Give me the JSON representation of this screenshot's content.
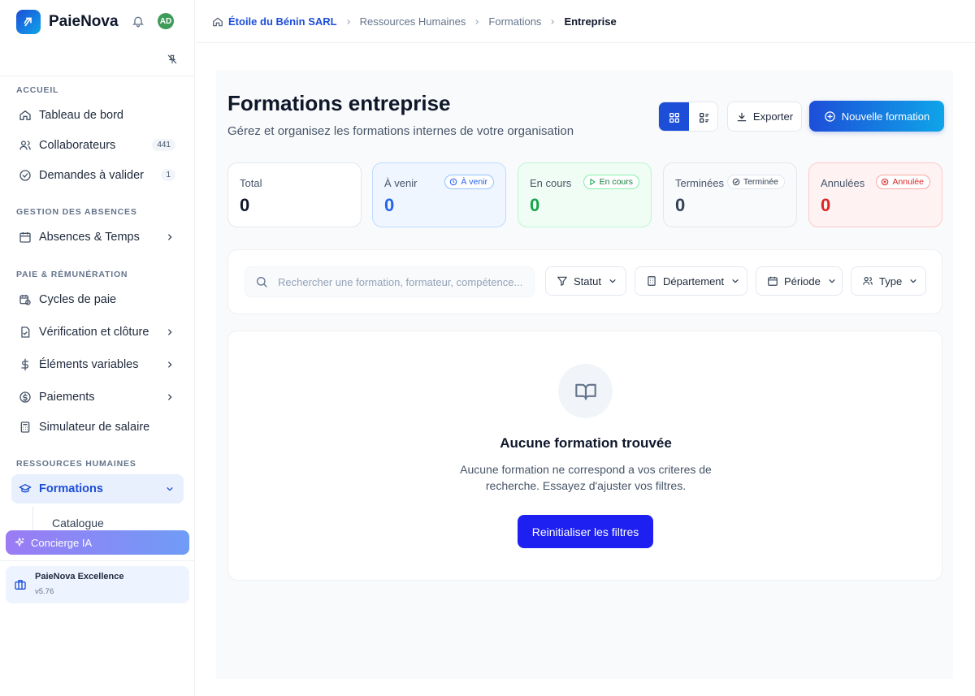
{
  "app": {
    "name": "PaieNova",
    "user_initials": "AD"
  },
  "sidebar": {
    "sections": {
      "accueil": "ACCUEIL",
      "absences": "GESTION DES ABSENCES",
      "paie": "PAIE & RÉMUNÉRATION",
      "rh": "RESSOURCES HUMAINES"
    },
    "items": {
      "dashboard": {
        "label": "Tableau de bord",
        "icon": "home-icon"
      },
      "collaborateurs": {
        "label": "Collaborateurs",
        "badge": "441",
        "icon": "users-icon"
      },
      "demandes": {
        "label": "Demandes à valider",
        "badge": "1",
        "icon": "check-circle-icon"
      },
      "absences": {
        "label": "Absences & Temps",
        "icon": "calendar-icon"
      },
      "cycles": {
        "label": "Cycles de paie",
        "icon": "calendar-clock-icon"
      },
      "verification": {
        "label": "Vérification et clôture",
        "icon": "file-check-icon"
      },
      "elements": {
        "label": "Éléments variables",
        "icon": "dollar-icon"
      },
      "paiements": {
        "label": "Paiements",
        "icon": "coin-icon"
      },
      "simulateur": {
        "label": "Simulateur de salaire",
        "icon": "calculator-icon"
      },
      "formations": {
        "label": "Formations",
        "icon": "graduation-cap-icon"
      }
    },
    "sub_items": {
      "catalogue": "Catalogue"
    },
    "concierge": "Concierge IA",
    "version": {
      "name": "PaieNova Excellence",
      "number": "v5.76"
    }
  },
  "breadcrumb": {
    "company": "Étoile du Bénin SARL",
    "rh": "Ressources Humaines",
    "formations": "Formations",
    "current": "Entreprise"
  },
  "header": {
    "title": "Formations entreprise",
    "subtitle": "Gérez et organisez les formations internes de votre organisation",
    "export_label": "Exporter",
    "new_label": "Nouvelle formation"
  },
  "stats": {
    "total": {
      "label": "Total",
      "value": "0"
    },
    "a_venir": {
      "label": "À venir",
      "value": "0",
      "pill": "À venir",
      "color": "#2563eb"
    },
    "en_cours": {
      "label": "En cours",
      "value": "0",
      "pill": "En cours",
      "color": "#16a34a"
    },
    "terminees": {
      "label": "Terminées",
      "value": "0",
      "pill": "Terminée",
      "color": "#334155"
    },
    "annulees": {
      "label": "Annulées",
      "value": "0",
      "pill": "Annulée",
      "color": "#dc2626"
    }
  },
  "filters": {
    "search_placeholder": "Rechercher une formation, formateur, compétence...",
    "statut": "Statut",
    "departement": "Département",
    "periode": "Période",
    "type": "Type"
  },
  "empty_state": {
    "title": "Aucune formation trouvée",
    "text": "Aucune formation ne correspond a vos criteres de recherche. Essayez d'ajuster vos filtres.",
    "reset_label": "Reinitialiser les filtres"
  }
}
